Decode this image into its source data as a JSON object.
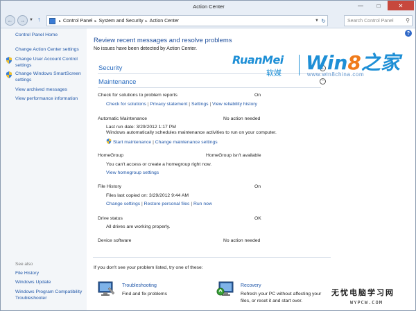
{
  "window": {
    "title": "Action Center"
  },
  "address": {
    "crumbs": [
      "Control Panel",
      "System and Security",
      "Action Center"
    ],
    "search_placeholder": "Search Control Panel"
  },
  "sidebar": {
    "home": "Control Panel Home",
    "items": [
      "Change Action Center settings",
      "Change User Account Control settings",
      "Change Windows SmartScreen settings",
      "View archived messages",
      "View performance information"
    ],
    "see_also_label": "See also",
    "see_also": [
      "File History",
      "Windows Update",
      "Windows Program Compatibility Troubleshooter"
    ]
  },
  "main": {
    "title": "Review recent messages and resolve problems",
    "subtitle": "No issues have been detected by Action Center.",
    "security_title": "Security",
    "maintenance_title": "Maintenance",
    "solutions": {
      "label": "Check for solutions to problem reports",
      "status": "On",
      "links": [
        "Check for solutions",
        "Privacy statement",
        "Settings",
        "View reliability history"
      ]
    },
    "auto_maint": {
      "label": "Automatic Maintenance",
      "status": "No action needed",
      "last_run": "Last run date: 3/29/2012 1:17 PM",
      "desc": "Windows automatically schedules maintenance activities to run on your computer.",
      "links": [
        "Start maintenance",
        "Change maintenance settings"
      ]
    },
    "homegroup": {
      "label": "HomeGroup",
      "status": "HomeGroup isn't available",
      "desc": "You can't access or create a homegroup right now.",
      "link": "View homegroup settings"
    },
    "file_history": {
      "label": "File History",
      "status": "On",
      "desc": "Files last copied on: 3/29/2012 9:44 AM",
      "links": [
        "Change settings",
        "Restore personal files",
        "Run now"
      ]
    },
    "drive_status": {
      "label": "Drive status",
      "status": "OK",
      "desc": "All drives are working properly."
    },
    "device_software": {
      "label": "Device software",
      "status": "No action needed"
    },
    "bottom_intro": "If you don't see your problem listed, try one of these:",
    "troubleshooting": {
      "title": "Troubleshooting",
      "desc": "Find and fix problems"
    },
    "recovery": {
      "title": "Recovery",
      "desc": "Refresh your PC without affecting your files, or reset it and start over."
    }
  },
  "watermark": {
    "brand": "RuanMei",
    "brand_cn": "软媒",
    "win8_prefix": "Win",
    "win8_digit": "8",
    "win8_suffix": "之家",
    "url": "www.win8china.com",
    "bottom_cn": "无忧电脑学习网",
    "bottom_url": "WYPCW.COM"
  },
  "colors": {
    "link": "#1f56a8",
    "heading": "#2a6cbf",
    "close": "#c7483d",
    "watermark": "#1e8fd6",
    "watermark_accent": "#f07b1b"
  }
}
